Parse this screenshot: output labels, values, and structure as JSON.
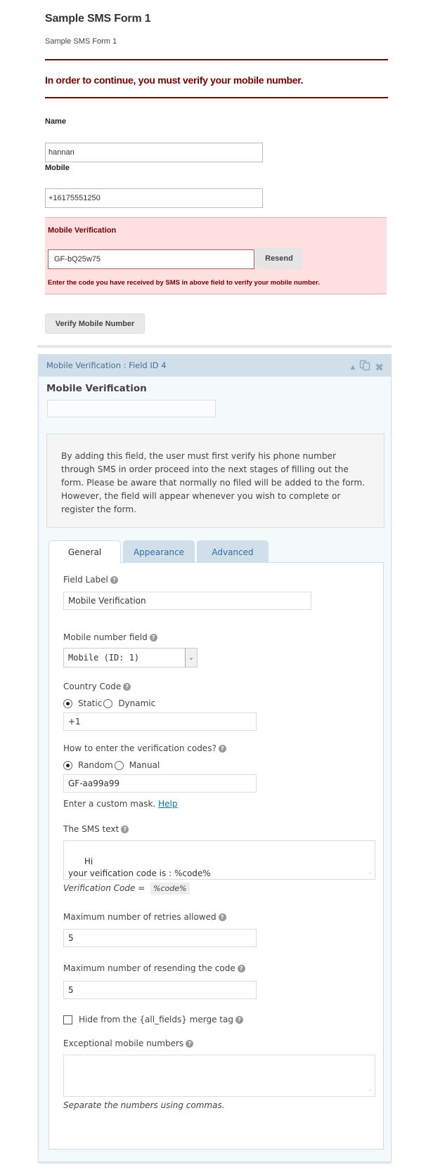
{
  "form": {
    "title": "Sample SMS Form 1",
    "description": "Sample SMS Form 1",
    "validation_message": "In order to continue, you must verify your mobile number.",
    "fields": {
      "name": {
        "label": "Name",
        "value": "hannan"
      },
      "mobile": {
        "label": "Mobile",
        "value": "+16175551250"
      },
      "verification": {
        "label": "Mobile Verification",
        "value": "GF-bQ25w75",
        "resend_label": "Resend",
        "hint": "Enter the code you have received by SMS in above field to verify your mobile number."
      }
    },
    "verify_button": "Verify Mobile Number",
    "colors": {
      "error": "#790000",
      "error_bg": "#ffdfe0"
    }
  },
  "editor": {
    "header_title": "Mobile Verification : Field ID 4",
    "header_icons": [
      "collapse-icon",
      "duplicate-icon",
      "delete-icon"
    ],
    "preview_label": "Mobile Verification",
    "description": "By adding this field, the user must first verify his phone number through SMS in order proceed into the next stages of filling out the form. Please be aware that normally no filed will be added to the form. However, the field will appear whenever you wish to complete or register the form.",
    "tabs": [
      {
        "label": "General",
        "active": true
      },
      {
        "label": "Appearance",
        "active": false
      },
      {
        "label": "Advanced",
        "active": false
      }
    ],
    "general": {
      "field_label": {
        "label": "Field Label",
        "value": "Mobile Verification"
      },
      "mobile_number_field": {
        "label": "Mobile number field",
        "selected": "Mobile (ID: 1)"
      },
      "country_code": {
        "label": "Country Code",
        "options": [
          "Static",
          "Dynamic"
        ],
        "selected": "Static",
        "value": "+1"
      },
      "code_entry": {
        "label": "How to enter the verification codes?",
        "options": [
          "Random",
          "Manual"
        ],
        "selected": "Random",
        "value": "GF-aa99a99",
        "mask_hint": "Enter a custom mask.",
        "help_link": "Help"
      },
      "sms_text": {
        "label": "The SMS text",
        "value": "Hi\nyour veification code is : %code%",
        "note_prefix": "Verification Code =",
        "note_code": "%code%"
      },
      "max_retries": {
        "label": "Maximum number of retries allowed",
        "value": "5"
      },
      "max_resend": {
        "label": "Maximum number of resending the code",
        "value": "5"
      },
      "hide_all_fields": {
        "label": "Hide from the {all_fields} merge tag",
        "checked": false
      },
      "exceptional_numbers": {
        "label": "Exceptional mobile numbers",
        "value": "",
        "hint": "Separate the numbers using commas."
      }
    },
    "colors": {
      "header_bg": "#d1dfea",
      "header_text": "#466f94",
      "panel_bg": "#f4f9fc",
      "link": "#0073aa"
    }
  }
}
